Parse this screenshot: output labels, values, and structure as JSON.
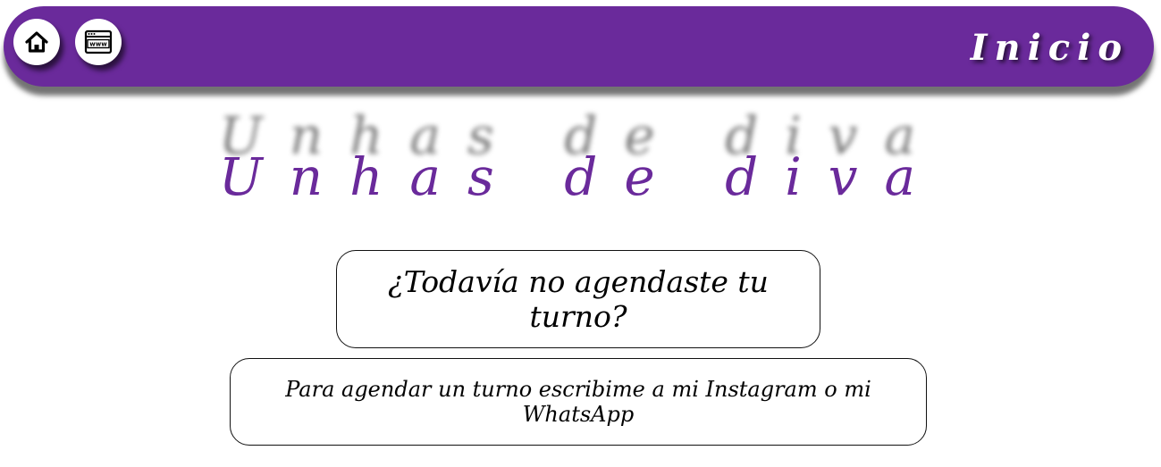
{
  "header": {
    "title": "Inicio",
    "home_icon": "home-icon",
    "web_icon": "www-browser-icon"
  },
  "brand": {
    "name": "Unhas de diva"
  },
  "content": {
    "question": "¿Todavía no agendaste tu turno?",
    "info": "Para agendar un turno escribime a mi Instagram o mi WhatsApp"
  },
  "colors": {
    "accent": "#6a2a9b",
    "background": "#ffffff"
  }
}
